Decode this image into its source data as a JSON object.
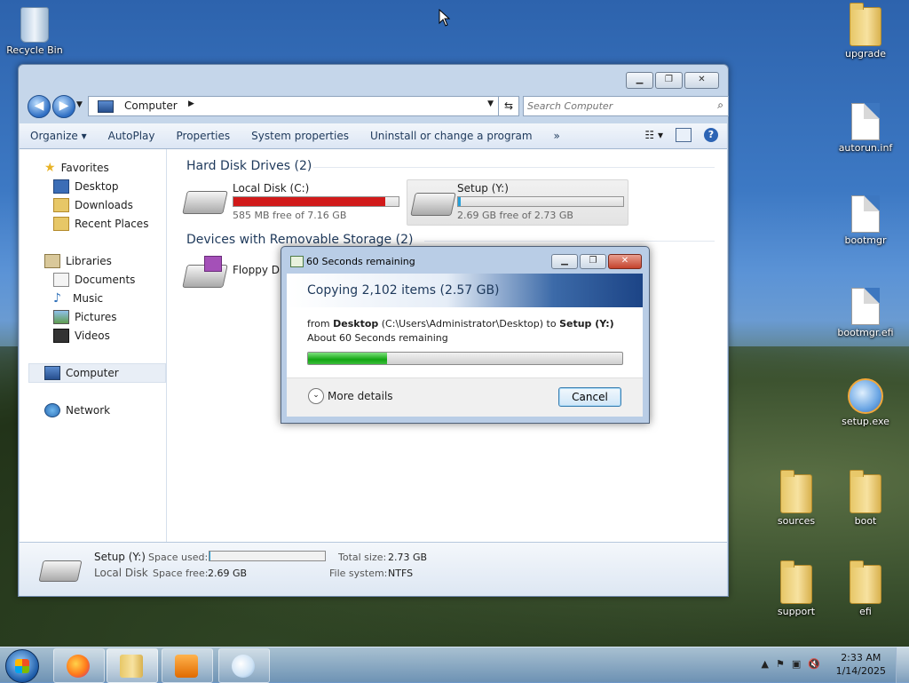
{
  "desktop": {
    "left_icons": [
      {
        "label": "Recycle Bin",
        "icon": "recycle-bin-icon"
      }
    ],
    "right_icons": [
      {
        "label": "upgrade",
        "icon": "folder-icon"
      },
      {
        "label": "autorun.inf",
        "icon": "settings-file-icon"
      },
      {
        "label": "bootmgr",
        "icon": "file-icon"
      },
      {
        "label": "bootmgr.efi",
        "icon": "file-icon"
      },
      {
        "label": "setup.exe",
        "icon": "setup-exe-icon"
      },
      {
        "label": "sources",
        "icon": "folder-icon"
      },
      {
        "label": "boot",
        "icon": "folder-icon"
      },
      {
        "label": "support",
        "icon": "folder-icon"
      },
      {
        "label": "efi",
        "icon": "folder-icon"
      }
    ]
  },
  "explorer": {
    "address": "Computer",
    "search_placeholder": "Search Computer",
    "toolbar": [
      "Organize ▾",
      "AutoPlay",
      "Properties",
      "System properties",
      "Uninstall or change a program",
      "»"
    ],
    "nav": {
      "favorites": "Favorites",
      "favorites_items": [
        "Desktop",
        "Downloads",
        "Recent Places"
      ],
      "libraries": "Libraries",
      "libraries_items": [
        "Documents",
        "Music",
        "Pictures",
        "Videos"
      ],
      "computer": "Computer",
      "network": "Network"
    },
    "groups": {
      "hdd": "Hard Disk Drives (2)",
      "removable": "Devices with Removable Storage (2)"
    },
    "drives": [
      {
        "name": "Local Disk (C:)",
        "free": "585 MB free of 7.16 GB",
        "used_fraction": 0.92,
        "bar_color": "#d11a1a"
      },
      {
        "name": "Setup (Y:)",
        "free": "2.69 GB free of 2.73 GB",
        "used_fraction": 0.015,
        "bar_color": "#26a0da"
      }
    ],
    "removable": [
      {
        "name": "Floppy Disk"
      }
    ],
    "details": {
      "drive_name": "Setup (Y:)",
      "drive_type": "Local Disk",
      "space_used_label": "Space used:",
      "space_used_fraction": 0.01,
      "space_free_label": "Space free:",
      "space_free": "2.69 GB",
      "total_size_label": "Total size:",
      "total_size": "2.73 GB",
      "fs_label": "File system:",
      "fs": "NTFS"
    }
  },
  "copy_dialog": {
    "title": "60 Seconds remaining",
    "heading": "Copying 2,102 items (2.57 GB)",
    "from_word": "from",
    "source": "Desktop",
    "source_path": "(C:\\Users\\Administrator\\Desktop)",
    "to_word": "to",
    "dest": "Setup (Y:)",
    "remaining": "About 60 Seconds remaining",
    "progress_fraction": 0.25,
    "more_details": "More details",
    "cancel": "Cancel"
  },
  "taskbar": {
    "apps": [
      "Firefox",
      "Windows Explorer",
      "Windows Media Player",
      "Paint"
    ],
    "time": "2:33 AM",
    "date": "1/14/2025"
  }
}
